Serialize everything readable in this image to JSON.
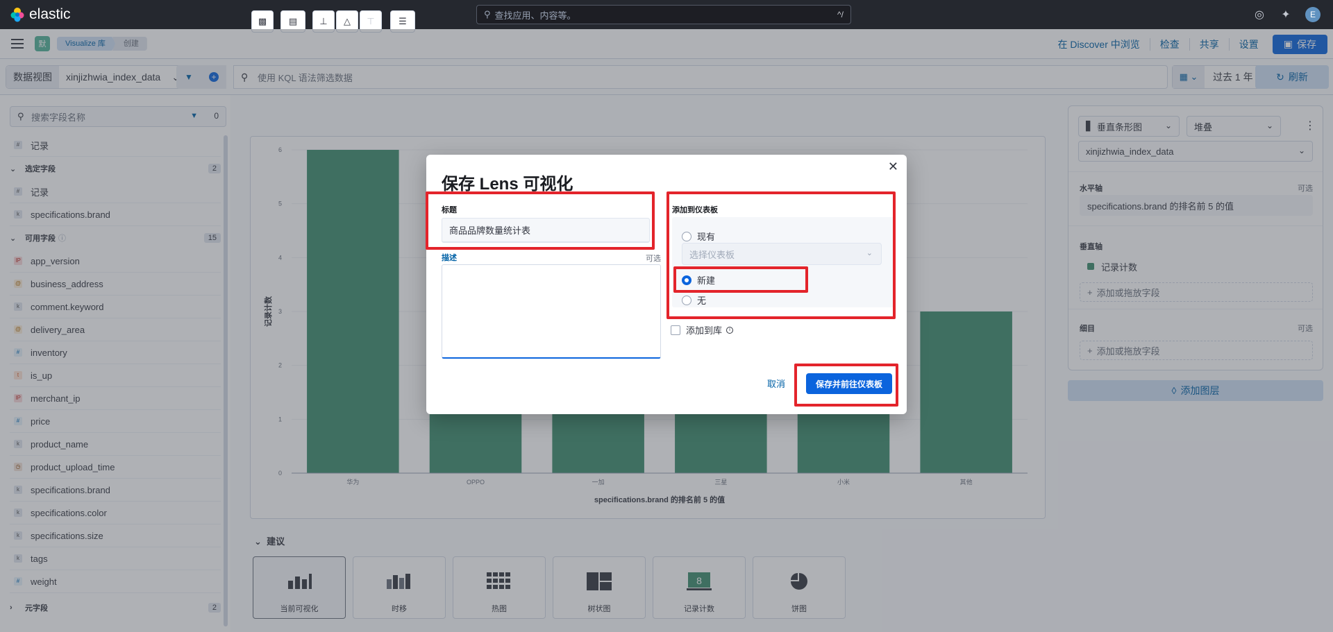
{
  "header": {
    "brand": "elastic",
    "search_placeholder": "查找应用、内容等。",
    "search_shortcut": "^/",
    "avatar_letter": "E"
  },
  "navbar": {
    "app_badge": "默",
    "breadcrumbs": [
      "Visualize 库",
      "创建"
    ],
    "links": [
      "在 Discover 中浏览",
      "检查",
      "共享",
      "设置"
    ],
    "save_label": "保存"
  },
  "querybar": {
    "dataview_label": "数据视图",
    "dataview_value": "xinjizhwia_index_data",
    "kql_placeholder": "使用 KQL 语法筛选数据",
    "date_value": "过去 1 年",
    "refresh_label": "刷新"
  },
  "sidebar": {
    "search_placeholder": "搜索字段名称",
    "filter_count": "0",
    "top_field": "记录",
    "selected_group": {
      "label": "选定字段",
      "count": "2",
      "fields": [
        "记录",
        "specifications.brand"
      ]
    },
    "available_group": {
      "label": "可用字段",
      "count": "15",
      "fields": [
        {
          "name": "app_version",
          "type": "ip"
        },
        {
          "name": "business_address",
          "type": "geo"
        },
        {
          "name": "comment.keyword",
          "type": "keyword"
        },
        {
          "name": "delivery_area",
          "type": "geo"
        },
        {
          "name": "inventory",
          "type": "num"
        },
        {
          "name": "is_up",
          "type": "bool"
        },
        {
          "name": "merchant_ip",
          "type": "ip"
        },
        {
          "name": "price",
          "type": "num"
        },
        {
          "name": "product_name",
          "type": "keyword"
        },
        {
          "name": "product_upload_time",
          "type": "date"
        },
        {
          "name": "specifications.brand",
          "type": "keyword"
        },
        {
          "name": "specifications.color",
          "type": "keyword"
        },
        {
          "name": "specifications.size",
          "type": "keyword"
        },
        {
          "name": "tags",
          "type": "keyword"
        },
        {
          "name": "weight",
          "type": "num"
        }
      ]
    },
    "meta_group": {
      "label": "元字段",
      "count": "2"
    }
  },
  "workspace": {
    "suggestions_title": "建议",
    "suggestions": [
      "当前可视化",
      "时移",
      "热图",
      "树状图",
      "记录计数",
      "饼图"
    ],
    "metric_value": "8"
  },
  "chart_data": {
    "type": "bar",
    "categories": [
      "华为",
      "OPPO",
      "一加",
      "三星",
      "小米",
      "其他"
    ],
    "values": [
      6,
      3,
      3,
      3,
      3,
      3
    ],
    "xlabel": "specifications.brand 的排名前 5 的值",
    "ylabel": "记录计数",
    "ylim": [
      0,
      6
    ],
    "yticks": [
      0,
      1,
      2,
      3,
      4,
      5,
      6
    ],
    "bar_color": "#3f8e6e"
  },
  "right_panel": {
    "chart_type": "垂直条形图",
    "stack_mode": "堆叠",
    "index": "xinjizhwia_index_data",
    "horizontal_axis": {
      "title": "水平轴",
      "optional": "可选",
      "value": "specifications.brand 的排名前 5 的值"
    },
    "vertical_axis": {
      "title": "垂直轴",
      "value": "记录计数",
      "add": "添加或拖放字段"
    },
    "breakdown": {
      "title": "细目",
      "optional": "可选",
      "add": "添加或拖放字段"
    },
    "add_layer": "添加图层"
  },
  "modal": {
    "title": "保存 Lens 可视化",
    "title_label": "标题",
    "title_value": "商品品牌数量统计表",
    "description_label": "描述",
    "optional": "可选",
    "dashboard_label": "添加到仪表板",
    "option_existing": "现有",
    "select_dashboard_placeholder": "选择仪表板",
    "option_new": "新建",
    "option_none": "无",
    "add_to_library": "添加到库",
    "cancel_label": "取消",
    "primary_label": "保存并前往仪表板"
  },
  "colors": {
    "highlight": "#e3242b",
    "primary": "#0b64dd",
    "bar": "#3f8e6e"
  }
}
